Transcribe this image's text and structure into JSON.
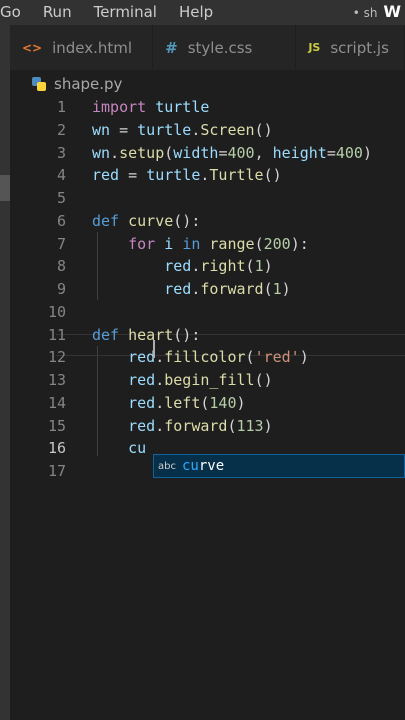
{
  "menu": [
    "Go",
    "Run",
    "Terminal",
    "Help"
  ],
  "title_fragment": {
    "dot": "•",
    "text": "sh",
    "bold": "W"
  },
  "tabs": [
    {
      "icon": "<>",
      "label": "index.html"
    },
    {
      "icon": "#",
      "label": "style.css"
    },
    {
      "icon": "JS",
      "label": "script.js"
    }
  ],
  "file": {
    "name": "shape.py"
  },
  "lines": [
    {
      "num": "1",
      "tokens": [
        [
          "kw2",
          "import"
        ],
        [
          "pn",
          " "
        ],
        [
          "id",
          "turtle"
        ]
      ]
    },
    {
      "num": "2",
      "tokens": [
        [
          "id",
          "wn"
        ],
        [
          "pn",
          " = "
        ],
        [
          "id",
          "turtle"
        ],
        [
          "pn",
          "."
        ],
        [
          "fn",
          "Screen"
        ],
        [
          "pn",
          "()"
        ]
      ]
    },
    {
      "num": "3",
      "tokens": [
        [
          "id",
          "wn"
        ],
        [
          "pn",
          "."
        ],
        [
          "fn",
          "setup"
        ],
        [
          "pn",
          "("
        ],
        [
          "id",
          "width"
        ],
        [
          "pn",
          "="
        ],
        [
          "num",
          "400"
        ],
        [
          "pn",
          ", "
        ],
        [
          "id",
          "height"
        ],
        [
          "pn",
          "="
        ],
        [
          "num",
          "400"
        ],
        [
          "pn",
          ")"
        ]
      ]
    },
    {
      "num": "4",
      "tokens": [
        [
          "id",
          "red"
        ],
        [
          "pn",
          " = "
        ],
        [
          "id",
          "turtle"
        ],
        [
          "pn",
          "."
        ],
        [
          "fn",
          "Turtle"
        ],
        [
          "pn",
          "()"
        ]
      ]
    },
    {
      "num": "5",
      "tokens": []
    },
    {
      "num": "6",
      "tokens": [
        [
          "kw",
          "def"
        ],
        [
          "pn",
          " "
        ],
        [
          "fn",
          "curve"
        ],
        [
          "pn",
          "():"
        ]
      ]
    },
    {
      "num": "7",
      "tokens": [
        [
          "pn",
          "    "
        ],
        [
          "kw2",
          "for"
        ],
        [
          "pn",
          " "
        ],
        [
          "id",
          "i"
        ],
        [
          "pn",
          " "
        ],
        [
          "kw",
          "in"
        ],
        [
          "pn",
          " "
        ],
        [
          "fn",
          "range"
        ],
        [
          "pn",
          "("
        ],
        [
          "num",
          "200"
        ],
        [
          "pn",
          "):"
        ]
      ]
    },
    {
      "num": "8",
      "tokens": [
        [
          "pn",
          "        "
        ],
        [
          "id",
          "red"
        ],
        [
          "pn",
          "."
        ],
        [
          "fn",
          "right"
        ],
        [
          "pn",
          "("
        ],
        [
          "num",
          "1"
        ],
        [
          "pn",
          ")"
        ]
      ]
    },
    {
      "num": "9",
      "tokens": [
        [
          "pn",
          "        "
        ],
        [
          "id",
          "red"
        ],
        [
          "pn",
          "."
        ],
        [
          "fn",
          "forward"
        ],
        [
          "pn",
          "("
        ],
        [
          "num",
          "1"
        ],
        [
          "pn",
          ")"
        ]
      ]
    },
    {
      "num": "10",
      "tokens": []
    },
    {
      "num": "11",
      "tokens": [
        [
          "kw",
          "def"
        ],
        [
          "pn",
          " "
        ],
        [
          "fn",
          "heart"
        ],
        [
          "pn",
          "():"
        ]
      ]
    },
    {
      "num": "12",
      "tokens": [
        [
          "pn",
          "    "
        ],
        [
          "id",
          "red"
        ],
        [
          "pn",
          "."
        ],
        [
          "fn",
          "fillcolor"
        ],
        [
          "pn",
          "("
        ],
        [
          "str",
          "'red'"
        ],
        [
          "pn",
          ")"
        ]
      ]
    },
    {
      "num": "13",
      "tokens": [
        [
          "pn",
          "    "
        ],
        [
          "id",
          "red"
        ],
        [
          "pn",
          "."
        ],
        [
          "fn",
          "begin_fill"
        ],
        [
          "pn",
          "()"
        ]
      ]
    },
    {
      "num": "14",
      "tokens": [
        [
          "pn",
          "    "
        ],
        [
          "id",
          "red"
        ],
        [
          "pn",
          "."
        ],
        [
          "fn",
          "left"
        ],
        [
          "pn",
          "("
        ],
        [
          "num",
          "140"
        ],
        [
          "pn",
          ")"
        ]
      ]
    },
    {
      "num": "15",
      "tokens": [
        [
          "pn",
          "    "
        ],
        [
          "id",
          "red"
        ],
        [
          "pn",
          "."
        ],
        [
          "fn",
          "forward"
        ],
        [
          "pn",
          "("
        ],
        [
          "num",
          "113"
        ],
        [
          "pn",
          ")"
        ]
      ]
    },
    {
      "num": "16",
      "tokens": [
        [
          "pn",
          "    "
        ],
        [
          "id",
          "cu"
        ]
      ]
    },
    {
      "num": "17",
      "tokens": []
    }
  ],
  "suggestion": {
    "kind": "abc",
    "match": "cu",
    "rest": "rve"
  },
  "colors": {
    "keyword": "#569cd6",
    "control": "#c586c0",
    "function": "#dcdcaa",
    "variable": "#9cdcfe",
    "number": "#b5cea8",
    "string": "#ce9178"
  }
}
